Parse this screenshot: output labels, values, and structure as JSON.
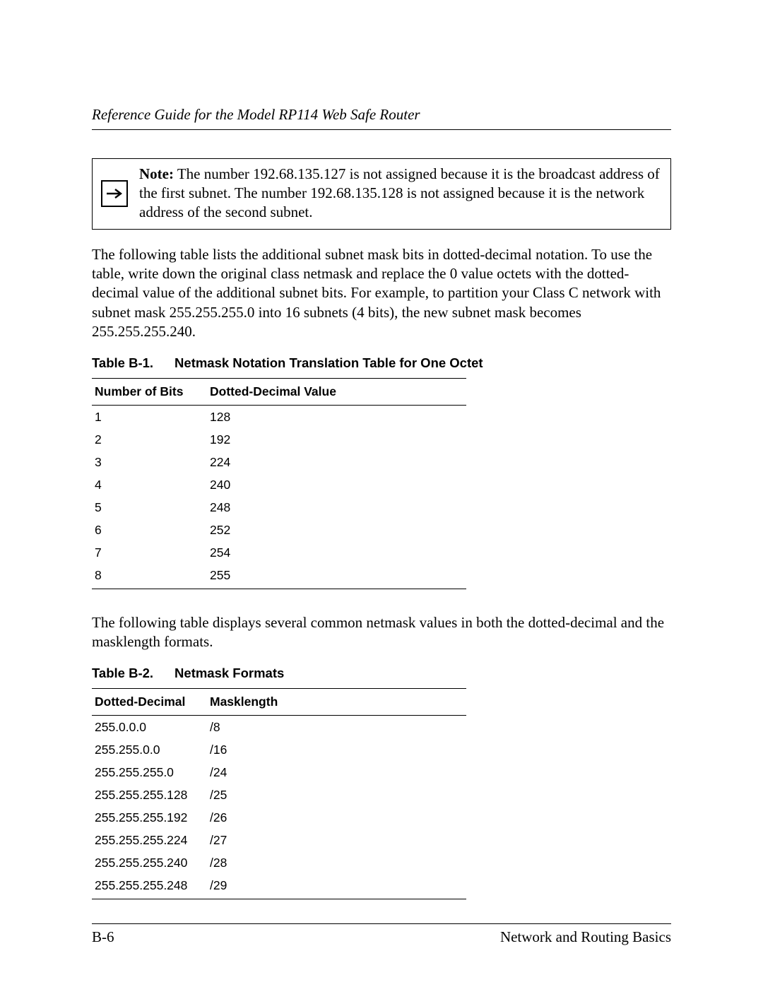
{
  "header": {
    "running_head": "Reference Guide for the Model RP114 Web Safe Router"
  },
  "note": {
    "label": "Note:",
    "text": "The number 192.68.135.127 is not assigned because it is the broadcast address of the first subnet. The number 192.68.135.128 is not assigned because it is the network address of the second subnet."
  },
  "para1": "The following table lists the additional subnet mask bits in dotted-decimal notation. To use the table, write down the original class netmask and replace the 0 value octets with the dotted-decimal value of the additional subnet bits. For example, to partition your Class C network with subnet mask 255.255.255.0 into 16 subnets (4 bits), the new subnet mask becomes 255.255.255.240.",
  "table1": {
    "cap_num": "Table B-1.",
    "cap_title": "Netmask Notation Translation Table for One Octet",
    "headers": [
      "Number of Bits",
      "Dotted-Decimal Value"
    ],
    "rows": [
      [
        "1",
        "128"
      ],
      [
        "2",
        "192"
      ],
      [
        "3",
        "224"
      ],
      [
        "4",
        "240"
      ],
      [
        "5",
        "248"
      ],
      [
        "6",
        "252"
      ],
      [
        "7",
        "254"
      ],
      [
        "8",
        "255"
      ]
    ]
  },
  "para2": "The following table displays several common netmask values in both the dotted-decimal and the masklength formats.",
  "table2": {
    "cap_num": "Table B-2.",
    "cap_title": "Netmask Formats",
    "headers": [
      "Dotted-Decimal",
      "Masklength"
    ],
    "rows": [
      [
        "255.0.0.0",
        "/8"
      ],
      [
        "255.255.0.0",
        "/16"
      ],
      [
        "255.255.255.0",
        "/24"
      ],
      [
        "255.255.255.128",
        "/25"
      ],
      [
        "255.255.255.192",
        "/26"
      ],
      [
        "255.255.255.224",
        "/27"
      ],
      [
        "255.255.255.240",
        "/28"
      ],
      [
        "255.255.255.248",
        "/29"
      ]
    ]
  },
  "footer": {
    "page_num": "B-6",
    "section": "Network and Routing Basics"
  }
}
